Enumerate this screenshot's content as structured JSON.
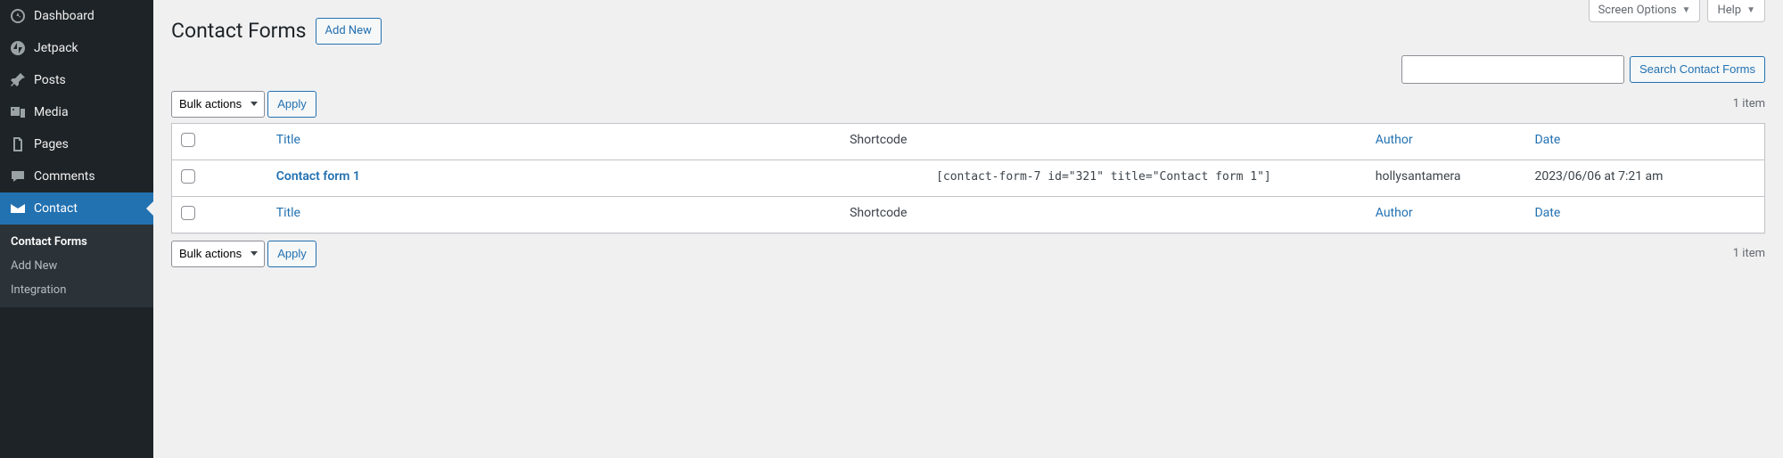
{
  "top_tabs": {
    "screen_options": "Screen Options",
    "help": "Help"
  },
  "sidebar": {
    "items": [
      {
        "label": "Dashboard"
      },
      {
        "label": "Jetpack"
      },
      {
        "label": "Posts"
      },
      {
        "label": "Media"
      },
      {
        "label": "Pages"
      },
      {
        "label": "Comments"
      },
      {
        "label": "Contact"
      }
    ],
    "submenu": [
      {
        "label": "Contact Forms",
        "current": true
      },
      {
        "label": "Add New",
        "current": false
      },
      {
        "label": "Integration",
        "current": false
      }
    ]
  },
  "header": {
    "title": "Contact Forms",
    "add_new": "Add New"
  },
  "search": {
    "button": "Search Contact Forms"
  },
  "bulk": {
    "label": "Bulk actions",
    "apply": "Apply"
  },
  "items_count": "1 item",
  "columns": {
    "title": "Title",
    "shortcode": "Shortcode",
    "author": "Author",
    "date": "Date"
  },
  "rows": [
    {
      "title": "Contact form 1",
      "shortcode": "[contact-form-7 id=\"321\" title=\"Contact form 1\"]",
      "author": "hollysantamera",
      "date": "2023/06/06 at 7:21 am"
    }
  ]
}
